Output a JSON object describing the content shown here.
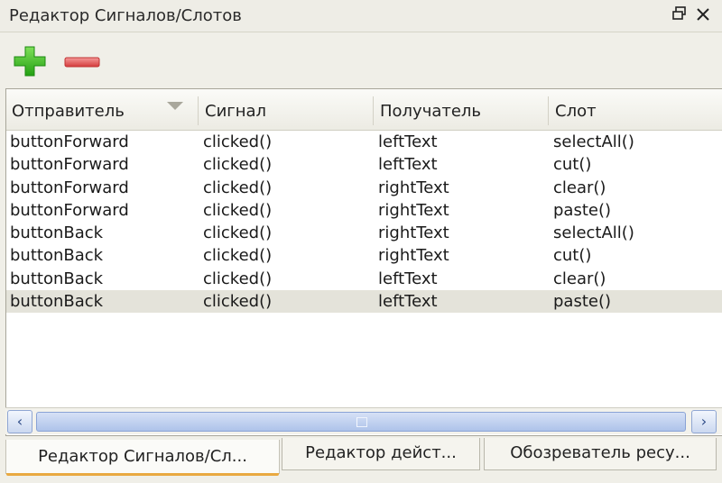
{
  "window": {
    "title": "Редактор Сигналов/Слотов",
    "float_icon": "float-window-icon",
    "close_icon": "close-icon"
  },
  "toolbar": {
    "add_icon": "plus-icon",
    "remove_icon": "minus-icon",
    "colors": {
      "add": "#3fbf1f",
      "remove": "#e05a5a"
    }
  },
  "table": {
    "columns": [
      "Отправитель",
      "Сигнал",
      "Получатель",
      "Слот"
    ],
    "sort_icon": "sort-down-icon",
    "rows": [
      [
        "buttonForward",
        "clicked()",
        "leftText",
        "selectAll()"
      ],
      [
        "buttonForward",
        "clicked()",
        "leftText",
        "cut()"
      ],
      [
        "buttonForward",
        "clicked()",
        "rightText",
        "clear()"
      ],
      [
        "buttonForward",
        "clicked()",
        "rightText",
        "paste()"
      ],
      [
        "buttonBack",
        "clicked()",
        "rightText",
        "selectAll()"
      ],
      [
        "buttonBack",
        "clicked()",
        "rightText",
        "cut()"
      ],
      [
        "buttonBack",
        "clicked()",
        "leftText",
        "clear()"
      ],
      [
        "buttonBack",
        "clicked()",
        "leftText",
        "paste()"
      ]
    ],
    "selected_row": 7
  },
  "scrollbar": {
    "left_icon": "chevron-left-icon",
    "right_icon": "chevron-right-icon",
    "left_glyph": "‹",
    "right_glyph": "›"
  },
  "tabs": [
    {
      "label": "Редактор Сигналов/Сл...",
      "active": true
    },
    {
      "label": "Редактор дейст...",
      "active": false
    },
    {
      "label": "Обозреватель ресу...",
      "active": false
    }
  ],
  "colors": {
    "accent_tab": "#e9a941",
    "scroll": "#aec3ea"
  }
}
